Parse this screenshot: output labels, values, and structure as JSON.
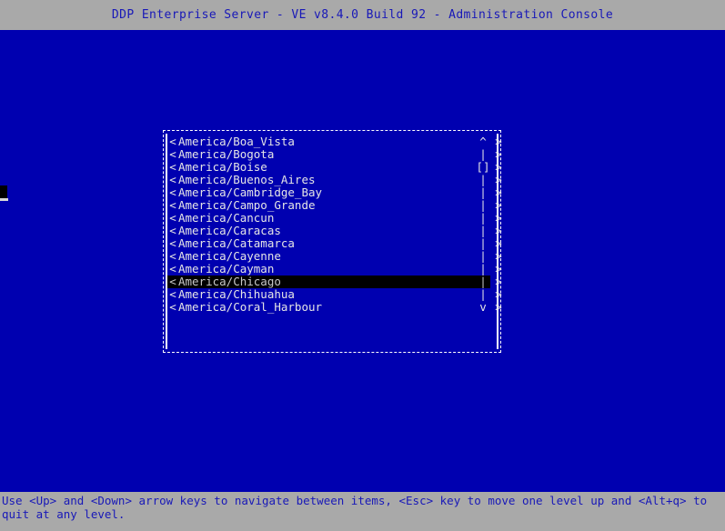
{
  "titlebar": {
    "title": "DDP Enterprise Server - VE v8.4.0 Build 92 - Administration Console"
  },
  "dialog": {
    "left_marker": "<",
    "right_marker": ">",
    "scroll": {
      "up_arrow": "^",
      "down_arrow": "v",
      "track": "|",
      "thumb": "[]"
    },
    "items": [
      {
        "label": "America/Boa_Vista",
        "scroll": "^",
        "selected": false
      },
      {
        "label": "America/Bogota",
        "scroll": "|",
        "selected": false
      },
      {
        "label": "America/Boise",
        "scroll": "[]",
        "selected": false
      },
      {
        "label": "America/Buenos_Aires",
        "scroll": "|",
        "selected": false
      },
      {
        "label": "America/Cambridge_Bay",
        "scroll": "|",
        "selected": false
      },
      {
        "label": "America/Campo_Grande",
        "scroll": "|",
        "selected": false
      },
      {
        "label": "America/Cancun",
        "scroll": "|",
        "selected": false
      },
      {
        "label": "America/Caracas",
        "scroll": "|",
        "selected": false
      },
      {
        "label": "America/Catamarca",
        "scroll": "|",
        "selected": false
      },
      {
        "label": "America/Cayenne",
        "scroll": "|",
        "selected": false
      },
      {
        "label": "America/Cayman",
        "scroll": "|",
        "selected": false
      },
      {
        "label": "America/Chicago",
        "scroll": "|",
        "selected": true
      },
      {
        "label": "America/Chihuahua",
        "scroll": "|",
        "selected": false
      },
      {
        "label": "America/Coral_Harbour",
        "scroll": "v",
        "selected": false
      }
    ]
  },
  "statusbar": {
    "hint": "Use <Up> and <Down> arrow keys to navigate between items, <Esc> key to move one level up and <Alt+q> to quit at any level."
  },
  "colors": {
    "background": "#0000b0",
    "chrome": "#a9a9a9",
    "chrome_text": "#1818b8",
    "list_text": "#e6e6e6",
    "selection_bg": "#000000",
    "border": "#ffffff"
  }
}
